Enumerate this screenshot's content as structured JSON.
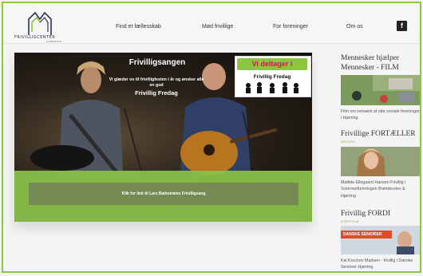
{
  "header": {
    "logo_text": "FRIVILLIGCENTER",
    "logo_sub": "HJØRRING",
    "nav": [
      "Find et fællesskab",
      "Mød frivillige",
      "For foreninger",
      "Om os"
    ],
    "facebook_label": "f"
  },
  "hero": {
    "title": "Frivilligsangen",
    "subtitle": "Vi glæder os til frivilligfesten i år og ønsker alle en god",
    "subtitle_strong": "Frivillig Fredag",
    "badge_top": "Vi deltager i",
    "badge_bottom": "Frivillig Fredag",
    "cta": "Klik for link til Lars Bækstrøms Frivilligsang"
  },
  "sidebar": {
    "items": [
      {
        "title": "Mennesker hjælper Mennesker - FILM",
        "tag": "",
        "text": "Film om netværk af otte sociale foreninger i Hjørring"
      },
      {
        "title": "Frivillige FORTÆLLER",
        "tag": "ARTIKEL",
        "text": "Matilde Ellegaard Hansen Frivillig i Scleroseforeningen Brønderslev & Hjørring"
      },
      {
        "title": "Frivillig FORDI",
        "tag": "KORTFILM",
        "banner": "DANSKE SENIORER",
        "text": "Kai Kruchov Madsen - frivillig i Danske Seniorer Hjørring"
      }
    ]
  },
  "colors": {
    "accent": "#8dc63f",
    "cta": "#748a52",
    "badge_text": "#d4145a"
  }
}
